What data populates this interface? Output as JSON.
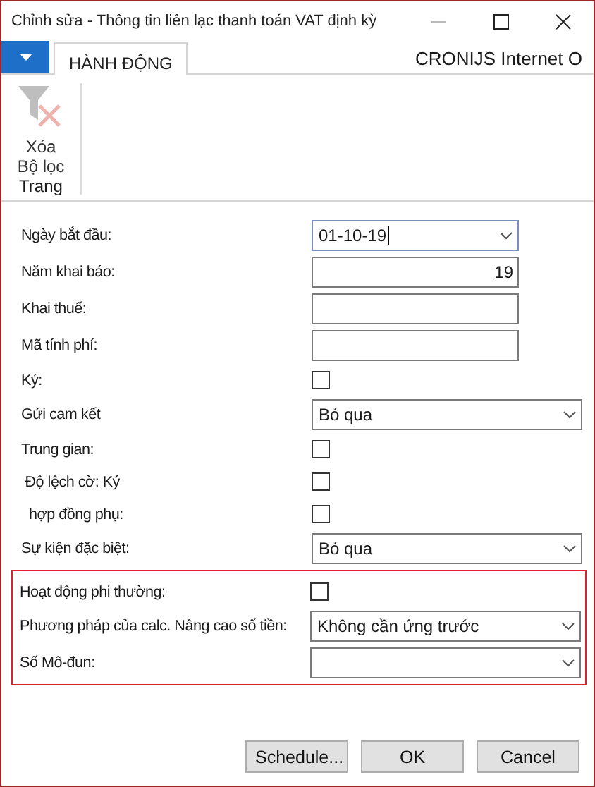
{
  "window": {
    "title": "Chỉnh sửa - Thông tin liên lạc thanh toán VAT định kỳ"
  },
  "ribbon": {
    "tabs": [
      {
        "label": "HÀNH ĐỘNG",
        "selected": true
      }
    ],
    "company": "CRONIJS Internet O",
    "groups": [
      {
        "label": "Trang",
        "actions": [
          {
            "label": "Xóa\nBộ lọc",
            "disabled": true
          }
        ]
      }
    ]
  },
  "form": {
    "sections": [
      {
        "highlighted": false,
        "fields": [
          {
            "kind": "date",
            "label": "Ngày bắt đầu:",
            "value": "01-10-19",
            "focused": true
          },
          {
            "kind": "number",
            "label": "Năm khai báo:",
            "value": "19"
          },
          {
            "kind": "text",
            "label": "Khai thuế:"
          },
          {
            "kind": "text",
            "label": "Mã tính phí:"
          },
          {
            "kind": "checkbox",
            "label": "Ký:",
            "checked": false
          },
          {
            "kind": "select",
            "label": "Gửi cam kết",
            "value": "Bỏ qua"
          },
          {
            "kind": "checkbox",
            "label": "Trung gian:",
            "checked": false
          },
          {
            "kind": "checkbox",
            "label": " Độ lệch cờ: Ký",
            "checked": false
          },
          {
            "kind": "checkbox",
            "label": "  hợp đồng phụ:",
            "checked": false
          },
          {
            "kind": "select",
            "label": "Sự kiện đặc biệt:",
            "value": "Bỏ qua"
          }
        ]
      },
      {
        "highlighted": true,
        "fields": [
          {
            "kind": "checkbox",
            "label": "Hoạt động phi thường:",
            "checked": false
          },
          {
            "kind": "select",
            "label": "Phương pháp của calc. Nâng cao số tiền:",
            "value": "Không cần ứng trước"
          },
          {
            "kind": "select",
            "label": "Số Mô-đun:"
          }
        ]
      }
    ]
  },
  "buttons": [
    "Schedule...",
    "OK",
    "Cancel"
  ]
}
